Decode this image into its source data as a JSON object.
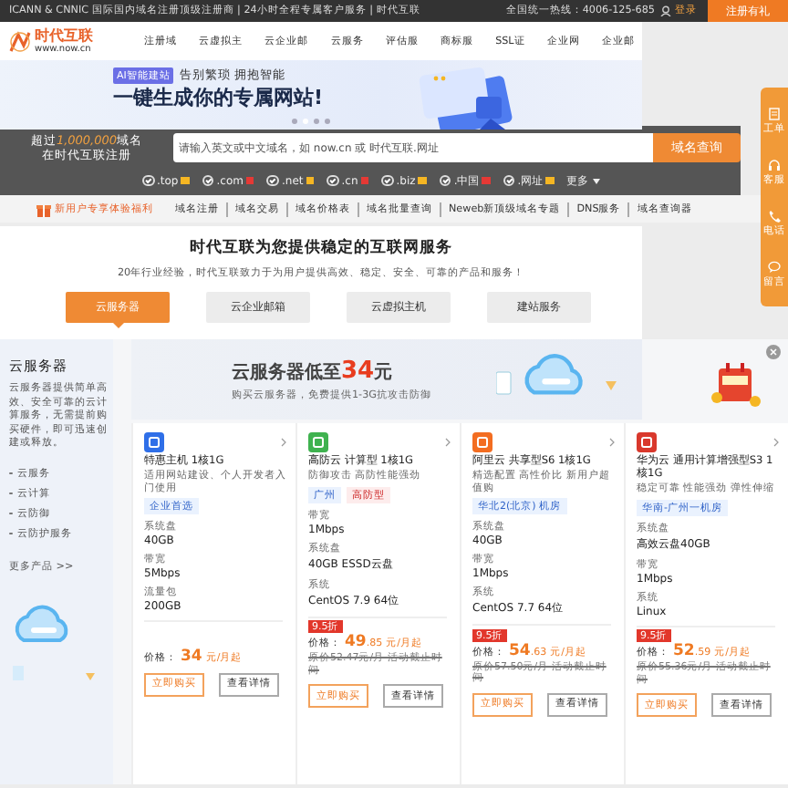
{
  "top_bar": {
    "notice": "ICANN & CNNIC 国际国内域名注册顶级注册商 | 24小时全程专属客户服务 | 时代互联",
    "hotline": "全国统一热线：4006-125-685",
    "login": "登录",
    "register": "注册有礼"
  },
  "logo": {
    "name": "时代互联",
    "url": "www.now.cn"
  },
  "nav": [
    "注册域",
    "云虚拟主",
    "云企业邮",
    "云服务",
    "评估服",
    "商标服",
    "SSL证",
    "企业网",
    "企业邮"
  ],
  "banner": {
    "badge": "AI智能建站",
    "tagline": "告别繁琐 拥抱智能",
    "headline": "一键生成你的专属网站!",
    "dots": [
      {
        "selected": false
      },
      {
        "selected": true
      },
      {
        "selected": false
      },
      {
        "selected": false
      }
    ]
  },
  "domain_search": {
    "lead": "超过",
    "count": "1,000,000",
    "unit": "域名",
    "subtitle": "在时代互联注册",
    "placeholder": "请输入英文或中文域名，如 now.cn 或 时代互联.网址",
    "button": "域名查询",
    "more": "更多",
    "suffixes": [
      {
        "label": ".top",
        "checked": true,
        "color": "#f5b623"
      },
      {
        "label": ".com",
        "checked": true,
        "color": "#e53935"
      },
      {
        "label": ".net",
        "checked": true,
        "color": "#f5b623"
      },
      {
        "label": ".cn",
        "checked": true,
        "color": "#e53935"
      },
      {
        "label": ".biz",
        "checked": true,
        "color": "#f5b623"
      },
      {
        "label": ".中国",
        "checked": true,
        "color": "#e53935"
      },
      {
        "label": ".网址",
        "checked": true,
        "color": "#f5b623"
      }
    ]
  },
  "quick_links": {
    "promo": "新用户专享体验福利",
    "links": [
      "域名注册",
      "域名交易",
      "域名价格表",
      "域名批量查询",
      "Neweb新顶级域名专题",
      "DNS服务",
      "域名查询器"
    ]
  },
  "side_tools": [
    {
      "label": "工单",
      "kind": "ticket"
    },
    {
      "label": "客服",
      "kind": "headset"
    },
    {
      "label": "电话",
      "kind": "phone"
    },
    {
      "label": "留言",
      "kind": "chat"
    }
  ],
  "services": {
    "title": "时代互联为您提供稳定的互联网服务",
    "subtitle": "20年行业经验，时代互联致力于为用户提供高效、稳定、安全、可靠的产品和服务！",
    "tabs": [
      {
        "label": "云服务器",
        "selected": true
      },
      {
        "label": "云企业邮箱",
        "selected": false
      },
      {
        "label": "云虚拟主机",
        "selected": false
      },
      {
        "label": "建站服务",
        "selected": false
      }
    ]
  },
  "product_intro": {
    "title": "云服务器",
    "description": "云服务器提供简单高效、安全可靠的云计算服务，无需提前购买硬件，即可迅速创建或释放。",
    "links": [
      "云服务",
      "云计算",
      "云防御",
      "云防护服务"
    ],
    "more": "更多产品 >>"
  },
  "promo_banner": {
    "lead": "云服务器低至",
    "price": "34",
    "unit": "元",
    "subtitle": "购买云服务器，免费提供1-3G抗攻击防御"
  },
  "products": [
    {
      "title": "特惠主机 1核1G",
      "color": "#2f6fe8",
      "description": "适用网站建设、个人开发者入门使用",
      "tags": [
        {
          "label": "企业首选",
          "kind": "blue"
        }
      ],
      "specs": [
        {
          "label": "系统盘",
          "value": "40GB"
        },
        {
          "label": "带宽",
          "value": "5Mbps"
        },
        {
          "label": "流量包",
          "value": "200GB"
        }
      ],
      "price_label": "价格：",
      "price_int": "34",
      "price_unit": "元/月起",
      "buy": "立即购买",
      "details": "查看详情"
    },
    {
      "title": "高防云 计算型 1核1G",
      "color": "#3fb24f",
      "description": "防御攻击 高防性能强劲",
      "tags": [
        {
          "label": "广州",
          "kind": "blue"
        },
        {
          "label": "高防型",
          "kind": "red"
        }
      ],
      "specs": [
        {
          "label": "带宽",
          "value": "1Mbps"
        },
        {
          "label": "系统盘",
          "value": "40GB ESSD云盘"
        },
        {
          "label": "系统",
          "value": "CentOS 7.9 64位"
        }
      ],
      "discount": "9.5折",
      "price_label": "价格：",
      "price_int": "49",
      "price_dec": ".85",
      "price_unit": "元/月起",
      "original": "原价52.47元/月 活动截止时间",
      "buy": "立即购买",
      "details": "查看详情"
    },
    {
      "title": "阿里云 共享型S6 1核1G",
      "color": "#f36d21",
      "description": "精选配置 高性价比 新用户超值购",
      "tags": [
        {
          "label": "华北2(北京) 机房",
          "kind": "blue"
        }
      ],
      "specs": [
        {
          "label": "系统盘",
          "value": "40GB"
        },
        {
          "label": "带宽",
          "value": "1Mbps"
        },
        {
          "label": "系统",
          "value": "CentOS 7.7 64位"
        }
      ],
      "discount": "9.5折",
      "price_label": "价格：",
      "price_int": "54",
      "price_dec": ".63",
      "price_unit": "元/月起",
      "original": "原价57.50元/月 活动截止时间",
      "buy": "立即购买",
      "details": "查看详情"
    },
    {
      "title": "华为云 通用计算增强型S3 1核1G",
      "color": "#d9382c",
      "description": "稳定可靠 性能强劲 弹性伸缩",
      "tags": [
        {
          "label": "华南-广州一机房",
          "kind": "blue"
        }
      ],
      "specs": [
        {
          "label": "系统盘",
          "value": "高效云盘40GB"
        },
        {
          "label": "带宽",
          "value": "1Mbps"
        },
        {
          "label": "系统",
          "value": "Linux"
        }
      ],
      "discount": "9.5折",
      "price_label": "价格：",
      "price_int": "52",
      "price_dec": ".59",
      "price_unit": "元/月起",
      "original": "原价55.36元/月 活动截止时间",
      "buy": "立即购买",
      "details": "查看详情"
    }
  ]
}
